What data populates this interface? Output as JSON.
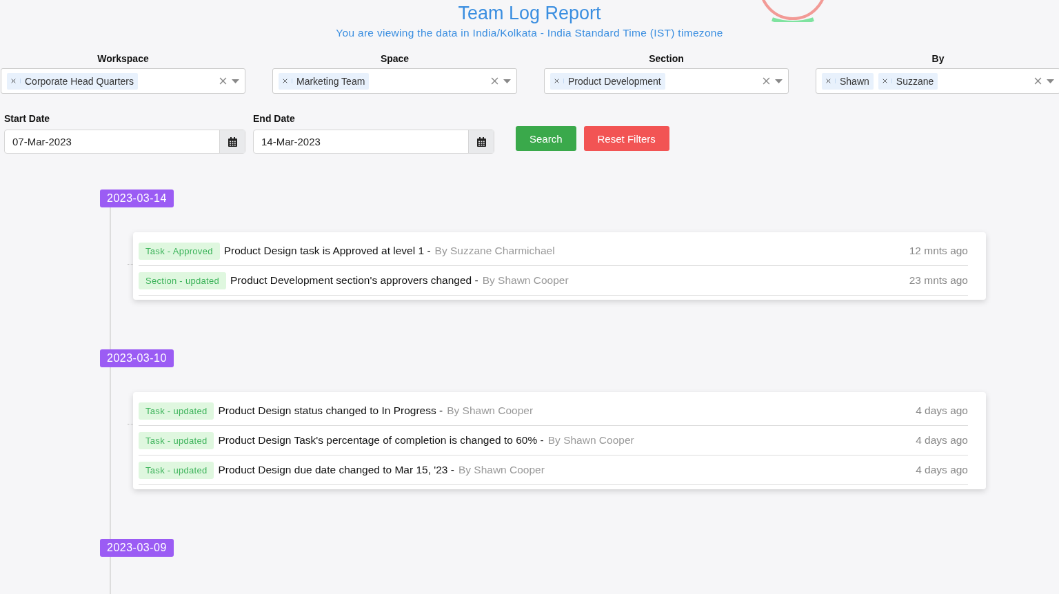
{
  "header": {
    "title": "Team Log Report",
    "subtitle": "You are viewing the data in India/Kolkata - India Standard Time (IST) timezone"
  },
  "filters": [
    {
      "label": "Workspace",
      "chips": [
        "Corporate Head Quarters"
      ]
    },
    {
      "label": "Space",
      "chips": [
        "Marketing Team"
      ]
    },
    {
      "label": "Section",
      "chips": [
        "Product Development"
      ]
    },
    {
      "label": "By",
      "chips": [
        "Shawn",
        "Suzzane"
      ]
    }
  ],
  "dates": [
    {
      "label": "Start Date",
      "value": "07-Mar-2023"
    },
    {
      "label": "End Date",
      "value": "14-Mar-2023"
    }
  ],
  "buttons": [
    {
      "label": "Search",
      "kind": "primary"
    },
    {
      "label": "Reset Filters",
      "kind": "danger"
    }
  ],
  "timeline": [
    {
      "date": "2023-03-14",
      "entries": [
        {
          "tag": "Task - Approved",
          "message": "Product Design task is Approved at level 1 -",
          "by": "By Suzzane Charmichael",
          "time": "12 mnts ago"
        },
        {
          "tag": "Section - updated",
          "message": "Product Development section's approvers changed -",
          "by": "By Shawn Cooper",
          "time": "23 mnts ago"
        }
      ]
    },
    {
      "date": "2023-03-10",
      "entries": [
        {
          "tag": "Task - updated",
          "message": "Product Design status changed to In Progress -",
          "by": "By Shawn Cooper",
          "time": "4 days ago"
        },
        {
          "tag": "Task - updated",
          "message": "Product Design Task's percentage of completion is changed to 60% -",
          "by": "By Shawn Cooper",
          "time": "4 days ago"
        },
        {
          "tag": "Task - updated",
          "message": "Product Design due date changed to Mar 15, '23 -",
          "by": "By Shawn Cooper",
          "time": "4 days ago"
        }
      ]
    },
    {
      "date": "2023-03-09"
    }
  ]
}
